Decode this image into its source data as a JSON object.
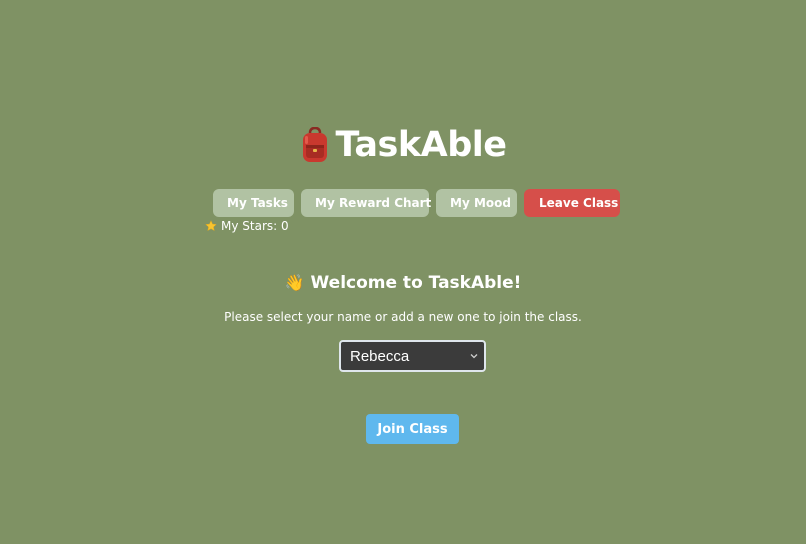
{
  "app": {
    "title": "TaskAble",
    "logo_icon": "backpack-icon"
  },
  "nav": {
    "buttons": [
      {
        "label": "My Tasks"
      },
      {
        "label": "My Reward Chart"
      },
      {
        "label": "My Mood"
      },
      {
        "label": "Leave Class"
      }
    ]
  },
  "stars": {
    "icon": "star-icon",
    "label": "My Stars: 0"
  },
  "welcome": {
    "icon": "👋",
    "title": "Welcome to TaskAble!",
    "instructions": "Please select your name or add a new one to join the class."
  },
  "name_select": {
    "selected": "Rebecca"
  },
  "join_button": {
    "label": "Join Class"
  },
  "colors": {
    "background": "#7f9264",
    "nav_button": "#b1c2a3",
    "leave_button": "#d64f4a",
    "join_button": "#5fb8ee",
    "select_background": "#3b3b3b"
  }
}
